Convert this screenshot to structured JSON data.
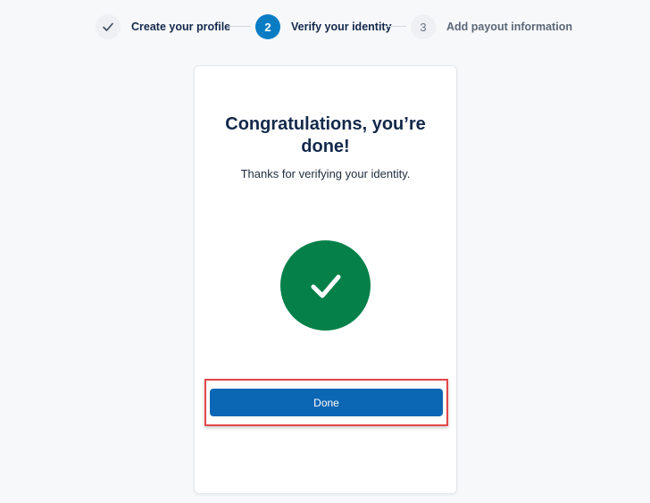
{
  "stepper": {
    "steps": [
      {
        "number": "",
        "label": "Create your profile",
        "state": "completed",
        "icon": "check-icon"
      },
      {
        "number": "2",
        "label": "Verify your identity",
        "state": "active"
      },
      {
        "number": "3",
        "label": "Add payout information",
        "state": "pending"
      }
    ]
  },
  "card": {
    "title": "Congratulations, you’re done!",
    "subtitle": "Thanks for verifying your identity.",
    "success_icon": "check-circle-icon",
    "done_label": "Done"
  },
  "colors": {
    "brand_blue": "#0b66b4",
    "active_step": "#0a7cc4",
    "success_green": "#058048",
    "highlight_red": "#e2474b",
    "heading": "#13294b"
  }
}
